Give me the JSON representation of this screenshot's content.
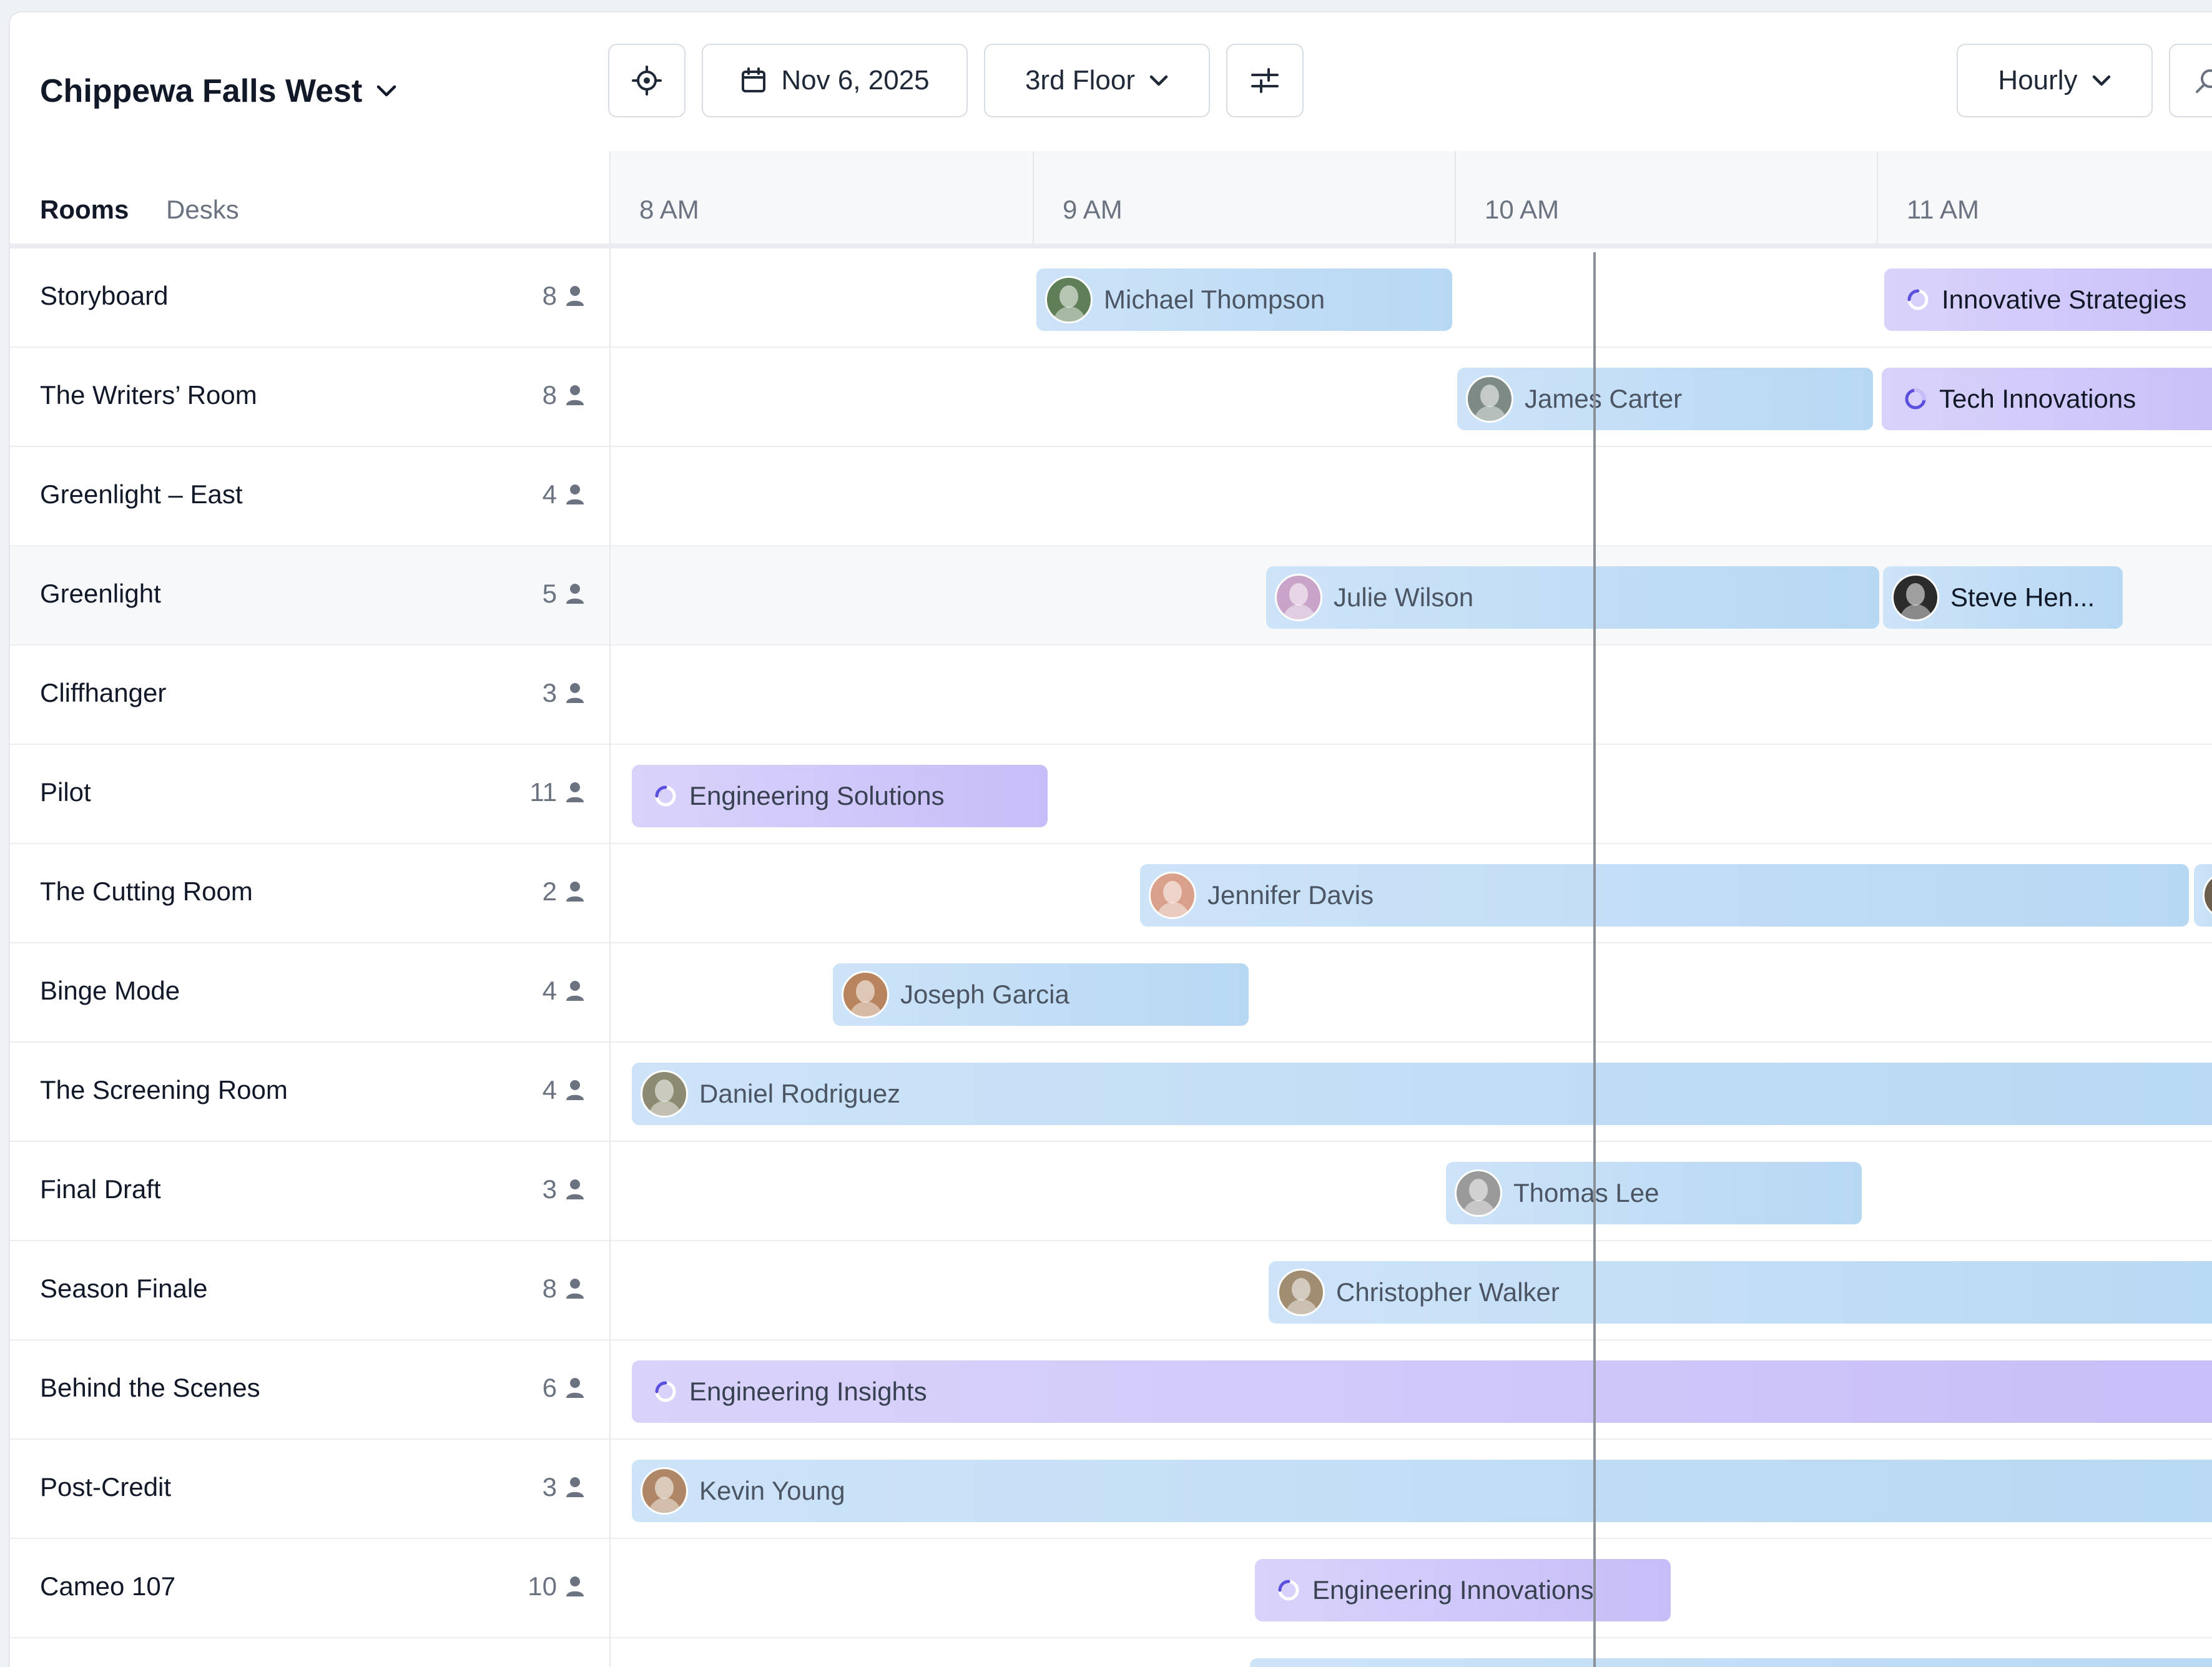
{
  "header": {
    "location": "Chippewa Falls West",
    "date": "Nov 6, 2025",
    "floor": "3rd Floor",
    "view": "Hourly",
    "icons": {
      "locate": "crosshair-icon",
      "calendar": "calendar-icon",
      "filters": "sliders-icon",
      "search": "search-icon"
    }
  },
  "tabs": {
    "rooms": "Rooms",
    "desks": "Desks",
    "active": "Rooms"
  },
  "hours": [
    "8 AM",
    "9 AM",
    "10 AM",
    "11 AM"
  ],
  "rooms": [
    {
      "name": "Storyboard",
      "capacity": "8"
    },
    {
      "name": "The Writers’ Room",
      "capacity": "8"
    },
    {
      "name": "Greenlight – East",
      "capacity": "4"
    },
    {
      "name": "Greenlight",
      "capacity": "5"
    },
    {
      "name": "Cliffhanger",
      "capacity": "3"
    },
    {
      "name": "Pilot",
      "capacity": "11"
    },
    {
      "name": "The Cutting Room",
      "capacity": "2"
    },
    {
      "name": "Binge Mode",
      "capacity": "4"
    },
    {
      "name": "The Screening Room",
      "capacity": "4"
    },
    {
      "name": "Final Draft",
      "capacity": "3"
    },
    {
      "name": "Season Finale",
      "capacity": "8"
    },
    {
      "name": "Behind the Scenes",
      "capacity": "6"
    },
    {
      "name": "Post-Credit",
      "capacity": "3"
    },
    {
      "name": "Cameo 107",
      "capacity": "10"
    }
  ],
  "bookings": [
    {
      "label": "Michael Thompson",
      "kind": "person"
    },
    {
      "label": "Innovative Strategies",
      "kind": "org"
    },
    {
      "label": "James Carter",
      "kind": "person"
    },
    {
      "label": "Tech Innovations",
      "kind": "org"
    },
    {
      "label": "Julie Wilson",
      "kind": "person"
    },
    {
      "label": "Steve Hen...",
      "kind": "person"
    },
    {
      "label": "Engineering Solutions",
      "kind": "org"
    },
    {
      "label": "Jennifer Davis",
      "kind": "person"
    },
    {
      "label": "Joseph Garcia",
      "kind": "person"
    },
    {
      "label": "Daniel Rodriguez",
      "kind": "person"
    },
    {
      "label": "Thomas Lee",
      "kind": "person"
    },
    {
      "label": "Christopher Walker",
      "kind": "person"
    },
    {
      "label": "Engineering Insights",
      "kind": "org"
    },
    {
      "label": "Kevin Young",
      "kind": "person"
    },
    {
      "label": "Engineering Innovations",
      "kind": "org"
    }
  ],
  "colors": {
    "person_booking": "#cde3f8",
    "org_booking": "#d9d3fb",
    "spinner": "#5b4fe0",
    "now_line": "#8a8f98"
  }
}
